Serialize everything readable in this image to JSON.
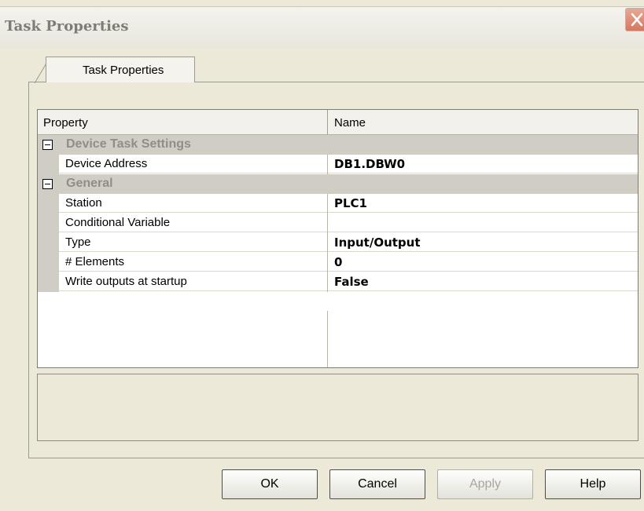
{
  "window": {
    "title": "Task Properties"
  },
  "tabs": [
    {
      "label": "Task Properties"
    }
  ],
  "grid": {
    "columns": [
      "Property",
      "Name"
    ],
    "groups": [
      {
        "label": "Device Task Settings",
        "rows": [
          {
            "property": "Device Address",
            "value": "DB1.DBW0"
          }
        ]
      },
      {
        "label": "General",
        "rows": [
          {
            "property": "Station",
            "value": "PLC1"
          },
          {
            "property": "Conditional Variable",
            "value": ""
          },
          {
            "property": "Type",
            "value": "Input/Output"
          },
          {
            "property": "# Elements",
            "value": "0"
          },
          {
            "property": "Write outputs at startup",
            "value": "False"
          }
        ]
      }
    ]
  },
  "buttons": {
    "ok": "OK",
    "cancel": "Cancel",
    "apply": "Apply",
    "help": "Help"
  },
  "colors": {
    "close_button": "#d6775f",
    "group_header": "#cfcdc4",
    "dialog_bg": "#ece9d8"
  },
  "icons": {
    "close": "close-icon",
    "collapse": "minus-box-icon"
  }
}
